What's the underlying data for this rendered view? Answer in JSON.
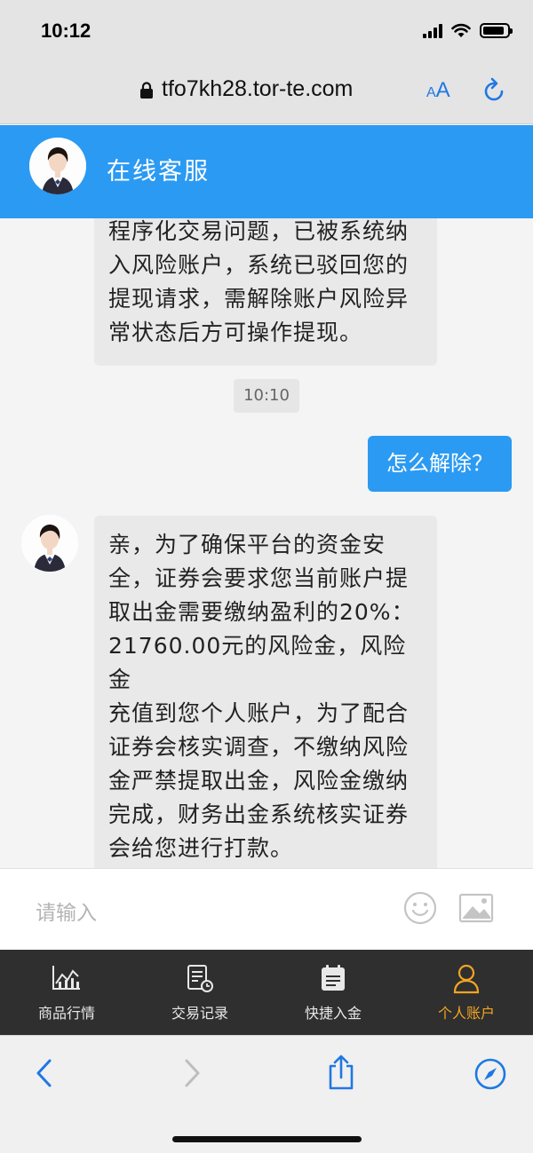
{
  "status_bar": {
    "time": "10:12",
    "battery_level": 0.9,
    "icons": [
      "cellular-signal-icon",
      "wifi-icon",
      "battery-icon"
    ]
  },
  "browser": {
    "url": "tfo7kh28.tor-te.com",
    "text_size_button": {
      "small": "A",
      "large": "A"
    },
    "icons": [
      "lock-icon",
      "text-size-icon",
      "reload-icon",
      "back-icon",
      "forward-icon",
      "share-icon",
      "compass-icon"
    ]
  },
  "header": {
    "title": "在线客服"
  },
  "chat": {
    "messages": [
      {
        "from": "agent",
        "lines": [
          "程序化交易问题，已被系统纳",
          "入风险账户，系统已驳回您的",
          "提现请求，需解除账户风险异",
          "常状态后方可操作提现。"
        ]
      },
      {
        "type": "time",
        "text": "10:10"
      },
      {
        "from": "user",
        "text": "怎么解除？"
      },
      {
        "from": "agent",
        "lines": [
          "亲，为了确保平台的资金安",
          "全，证券会要求您当前账户提",
          "取出金需要缴纳盈利的20%：",
          "21760.00元的风险金，风险金",
          "充值到您个人账户，为了配合",
          "证券会核实调查，不缴纳风险",
          "金严禁提取出金，风险金缴纳",
          "完成，财务出金系统核实证券",
          "会给您进行打款。"
        ]
      }
    ]
  },
  "input": {
    "placeholder": "请输入",
    "icons": [
      "emoji-icon",
      "image-icon"
    ]
  },
  "tabbar": {
    "items": [
      {
        "label": "商品行情",
        "icon": "chart-icon",
        "active": false
      },
      {
        "label": "交易记录",
        "icon": "records-icon",
        "active": false
      },
      {
        "label": "快捷入金",
        "icon": "calendar-icon",
        "active": false
      },
      {
        "label": "个人账户",
        "icon": "person-icon",
        "active": true
      }
    ],
    "active_color": "#f3a521"
  },
  "colors": {
    "brand_blue": "#2b9af3",
    "link_blue": "#1f78e3",
    "tabbar_bg": "#2f2f2f"
  }
}
